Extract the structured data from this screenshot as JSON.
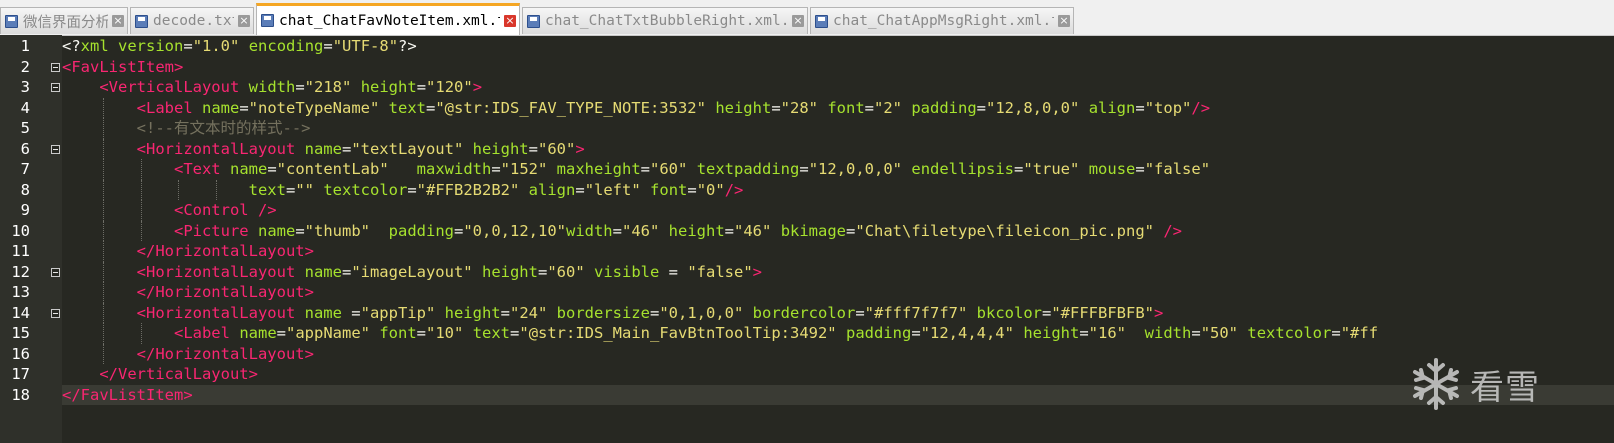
{
  "tabs": [
    {
      "label": "微信界面分析",
      "active": false
    },
    {
      "label": "decode.txt",
      "active": false
    },
    {
      "label": "chat_ChatFavNoteItem.xml.txt",
      "active": true
    },
    {
      "label": "chat_ChatTxtBubbleRight.xml.txt",
      "active": false
    },
    {
      "label": "chat_ChatAppMsgRight.xml.txt",
      "active": false
    }
  ],
  "editor": {
    "current_line": 18,
    "line_numbers": [
      "1",
      "2",
      "3",
      "4",
      "5",
      "6",
      "7",
      "8",
      "9",
      "10",
      "11",
      "12",
      "13",
      "14",
      "15",
      "16",
      "17",
      "18"
    ],
    "lines": [
      [
        [
          "op",
          "<?"
        ],
        [
          "attr",
          "xml"
        ],
        [
          "op",
          " "
        ],
        [
          "attr",
          "version"
        ],
        [
          "op",
          "="
        ],
        [
          "val",
          "\"1.0\""
        ],
        [
          "op",
          " "
        ],
        [
          "attr",
          "encoding"
        ],
        [
          "op",
          "="
        ],
        [
          "val",
          "\"UTF-8\""
        ],
        [
          "op",
          "?>"
        ]
      ],
      [
        [
          "tag",
          "<FavListItem>"
        ]
      ],
      [
        [
          "op",
          "    "
        ],
        [
          "tag",
          "<VerticalLayout"
        ],
        [
          "op",
          " "
        ],
        [
          "attr",
          "width"
        ],
        [
          "op",
          "="
        ],
        [
          "val",
          "\"218\""
        ],
        [
          "op",
          " "
        ],
        [
          "attr",
          "height"
        ],
        [
          "op",
          "="
        ],
        [
          "val",
          "\"120\""
        ],
        [
          "tag",
          ">"
        ]
      ],
      [
        [
          "op",
          "        "
        ],
        [
          "tag",
          "<Label"
        ],
        [
          "op",
          " "
        ],
        [
          "attr",
          "name"
        ],
        [
          "op",
          "="
        ],
        [
          "val",
          "\"noteTypeName\""
        ],
        [
          "op",
          " "
        ],
        [
          "attr",
          "text"
        ],
        [
          "op",
          "="
        ],
        [
          "val",
          "\"@str:IDS_FAV_TYPE_NOTE:3532\""
        ],
        [
          "op",
          " "
        ],
        [
          "attr",
          "height"
        ],
        [
          "op",
          "="
        ],
        [
          "val",
          "\"28\""
        ],
        [
          "op",
          " "
        ],
        [
          "attr",
          "font"
        ],
        [
          "op",
          "="
        ],
        [
          "val",
          "\"2\""
        ],
        [
          "op",
          " "
        ],
        [
          "attr",
          "padding"
        ],
        [
          "op",
          "="
        ],
        [
          "val",
          "\"12,8,0,0\""
        ],
        [
          "op",
          " "
        ],
        [
          "attr",
          "align"
        ],
        [
          "op",
          "="
        ],
        [
          "val",
          "\"top\""
        ],
        [
          "tag",
          "/>"
        ]
      ],
      [
        [
          "op",
          "        "
        ],
        [
          "cmt",
          "<!--有文本时的样式-->"
        ]
      ],
      [
        [
          "op",
          "        "
        ],
        [
          "tag",
          "<HorizontalLayout"
        ],
        [
          "op",
          " "
        ],
        [
          "attr",
          "name"
        ],
        [
          "op",
          "="
        ],
        [
          "val",
          "\"textLayout\""
        ],
        [
          "op",
          " "
        ],
        [
          "attr",
          "height"
        ],
        [
          "op",
          "="
        ],
        [
          "val",
          "\"60\""
        ],
        [
          "tag",
          ">"
        ]
      ],
      [
        [
          "op",
          "            "
        ],
        [
          "tag",
          "<Text"
        ],
        [
          "op",
          " "
        ],
        [
          "attr",
          "name"
        ],
        [
          "op",
          "="
        ],
        [
          "val",
          "\"contentLab\""
        ],
        [
          "op",
          "   "
        ],
        [
          "attr",
          "maxwidth"
        ],
        [
          "op",
          "="
        ],
        [
          "val",
          "\"152\""
        ],
        [
          "op",
          " "
        ],
        [
          "attr",
          "maxheight"
        ],
        [
          "op",
          "="
        ],
        [
          "val",
          "\"60\""
        ],
        [
          "op",
          " "
        ],
        [
          "attr",
          "textpadding"
        ],
        [
          "op",
          "="
        ],
        [
          "val",
          "\"12,0,0,0\""
        ],
        [
          "op",
          " "
        ],
        [
          "attr",
          "endellipsis"
        ],
        [
          "op",
          "="
        ],
        [
          "val",
          "\"true\""
        ],
        [
          "op",
          " "
        ],
        [
          "attr",
          "mouse"
        ],
        [
          "op",
          "="
        ],
        [
          "val",
          "\"false\""
        ]
      ],
      [
        [
          "op",
          "                    "
        ],
        [
          "attr",
          "text"
        ],
        [
          "op",
          "="
        ],
        [
          "val",
          "\"\""
        ],
        [
          "op",
          " "
        ],
        [
          "attr",
          "textcolor"
        ],
        [
          "op",
          "="
        ],
        [
          "val",
          "\"#FFB2B2B2\""
        ],
        [
          "op",
          " "
        ],
        [
          "attr",
          "align"
        ],
        [
          "op",
          "="
        ],
        [
          "val",
          "\"left\""
        ],
        [
          "op",
          " "
        ],
        [
          "attr",
          "font"
        ],
        [
          "op",
          "="
        ],
        [
          "val",
          "\"0\""
        ],
        [
          "tag",
          "/>"
        ]
      ],
      [
        [
          "op",
          "            "
        ],
        [
          "tag",
          "<Control />"
        ]
      ],
      [
        [
          "op",
          "            "
        ],
        [
          "tag",
          "<Picture"
        ],
        [
          "op",
          " "
        ],
        [
          "attr",
          "name"
        ],
        [
          "op",
          "="
        ],
        [
          "val",
          "\"thumb\""
        ],
        [
          "op",
          "  "
        ],
        [
          "attr",
          "padding"
        ],
        [
          "op",
          "="
        ],
        [
          "val",
          "\"0,0,12,10\""
        ],
        [
          "attr",
          "width"
        ],
        [
          "op",
          "="
        ],
        [
          "val",
          "\"46\""
        ],
        [
          "op",
          " "
        ],
        [
          "attr",
          "height"
        ],
        [
          "op",
          "="
        ],
        [
          "val",
          "\"46\""
        ],
        [
          "op",
          " "
        ],
        [
          "attr",
          "bkimage"
        ],
        [
          "op",
          "="
        ],
        [
          "val",
          "\"Chat\\filetype\\fileicon_pic.png\""
        ],
        [
          "op",
          " "
        ],
        [
          "tag",
          "/>"
        ]
      ],
      [
        [
          "op",
          "        "
        ],
        [
          "tag",
          "</HorizontalLayout>"
        ]
      ],
      [
        [
          "op",
          "        "
        ],
        [
          "tag",
          "<HorizontalLayout"
        ],
        [
          "op",
          " "
        ],
        [
          "attr",
          "name"
        ],
        [
          "op",
          "="
        ],
        [
          "val",
          "\"imageLayout\""
        ],
        [
          "op",
          " "
        ],
        [
          "attr",
          "height"
        ],
        [
          "op",
          "="
        ],
        [
          "val",
          "\"60\""
        ],
        [
          "op",
          " "
        ],
        [
          "attr",
          "visible"
        ],
        [
          "op",
          " = "
        ],
        [
          "val",
          "\"false\""
        ],
        [
          "tag",
          ">"
        ]
      ],
      [
        [
          "op",
          "        "
        ],
        [
          "tag",
          "</HorizontalLayout>"
        ]
      ],
      [
        [
          "op",
          "        "
        ],
        [
          "tag",
          "<HorizontalLayout"
        ],
        [
          "op",
          " "
        ],
        [
          "attr",
          "name"
        ],
        [
          "op",
          " ="
        ],
        [
          "val",
          "\"appTip\""
        ],
        [
          "op",
          " "
        ],
        [
          "attr",
          "height"
        ],
        [
          "op",
          "="
        ],
        [
          "val",
          "\"24\""
        ],
        [
          "op",
          " "
        ],
        [
          "attr",
          "bordersize"
        ],
        [
          "op",
          "="
        ],
        [
          "val",
          "\"0,1,0,0\""
        ],
        [
          "op",
          " "
        ],
        [
          "attr",
          "bordercolor"
        ],
        [
          "op",
          "="
        ],
        [
          "val",
          "\"#fff7f7f7\""
        ],
        [
          "op",
          " "
        ],
        [
          "attr",
          "bkcolor"
        ],
        [
          "op",
          "="
        ],
        [
          "val",
          "\"#FFFBFBFB\""
        ],
        [
          "tag",
          ">"
        ]
      ],
      [
        [
          "op",
          "            "
        ],
        [
          "tag",
          "<Label"
        ],
        [
          "op",
          " "
        ],
        [
          "attr",
          "name"
        ],
        [
          "op",
          "="
        ],
        [
          "val",
          "\"appName\""
        ],
        [
          "op",
          " "
        ],
        [
          "attr",
          "font"
        ],
        [
          "op",
          "="
        ],
        [
          "val",
          "\"10\""
        ],
        [
          "op",
          " "
        ],
        [
          "attr",
          "text"
        ],
        [
          "op",
          "="
        ],
        [
          "val",
          "\"@str:IDS_Main_FavBtnToolTip:3492\""
        ],
        [
          "op",
          " "
        ],
        [
          "attr",
          "padding"
        ],
        [
          "op",
          "="
        ],
        [
          "val",
          "\"12,4,4,4\""
        ],
        [
          "op",
          " "
        ],
        [
          "attr",
          "height"
        ],
        [
          "op",
          "="
        ],
        [
          "val",
          "\"16\""
        ],
        [
          "op",
          "  "
        ],
        [
          "attr",
          "width"
        ],
        [
          "op",
          "="
        ],
        [
          "val",
          "\"50\""
        ],
        [
          "op",
          " "
        ],
        [
          "attr",
          "textcolor"
        ],
        [
          "op",
          "="
        ],
        [
          "val",
          "\"#ff"
        ]
      ],
      [
        [
          "op",
          "        "
        ],
        [
          "tag",
          "</HorizontalLayout>"
        ]
      ],
      [
        [
          "op",
          "    "
        ],
        [
          "tag",
          "</VerticalLayout>"
        ]
      ],
      [
        [
          "tag",
          "</FavListItem>"
        ]
      ]
    ],
    "fold_lines": [
      2,
      3,
      6,
      12,
      14
    ]
  },
  "watermark": {
    "text": "看雪",
    "icon": "snowflake-icon"
  },
  "colors": {
    "background": "#272822",
    "tag": "#f92672",
    "attribute": "#a6e22e",
    "value": "#e6db74",
    "comment": "#75715e",
    "active_tab_accent": "#f5a623"
  }
}
